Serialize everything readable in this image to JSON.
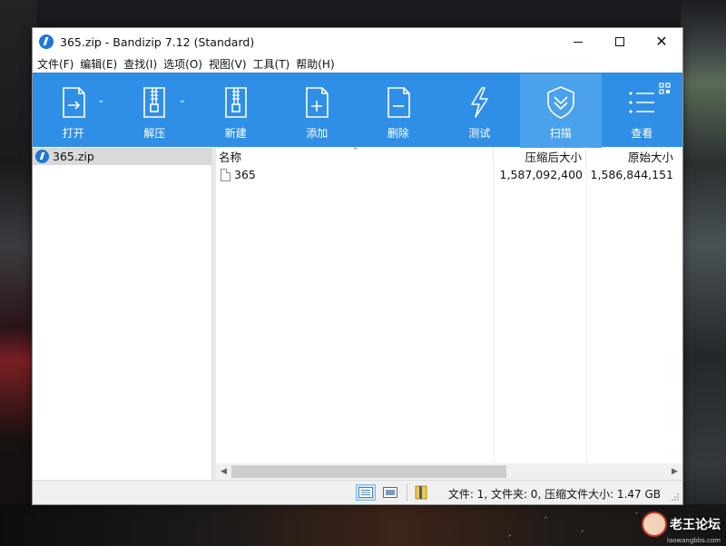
{
  "window": {
    "title": "365.zip - Bandizip 7.12 (Standard)"
  },
  "menu": [
    "文件(F)",
    "编辑(E)",
    "查找(I)",
    "选项(O)",
    "视图(V)",
    "工具(T)",
    "帮助(H)"
  ],
  "toolbar": {
    "open": "打开",
    "extract": "解压",
    "new": "新建",
    "add": "添加",
    "delete": "删除",
    "test": "测试",
    "scan": "扫描",
    "view": "查看"
  },
  "tree": {
    "root": "365.zip"
  },
  "list": {
    "headers": {
      "name": "名称",
      "compressed": "压缩后大小",
      "original": "原始大小"
    },
    "rows": [
      {
        "name": "365",
        "compressed": "1,587,092,400",
        "original": "1,586,844,151"
      }
    ]
  },
  "status": {
    "text": "文件: 1, 文件夹: 0, 压缩文件大小: 1.47 GB"
  },
  "watermark": {
    "text": "老王论坛",
    "sub": "laowangbbs.com"
  },
  "colors": {
    "toolbar": "#2f8fe6",
    "toolbar_active": "#4aa2ec",
    "accent": "#1e78d2"
  }
}
